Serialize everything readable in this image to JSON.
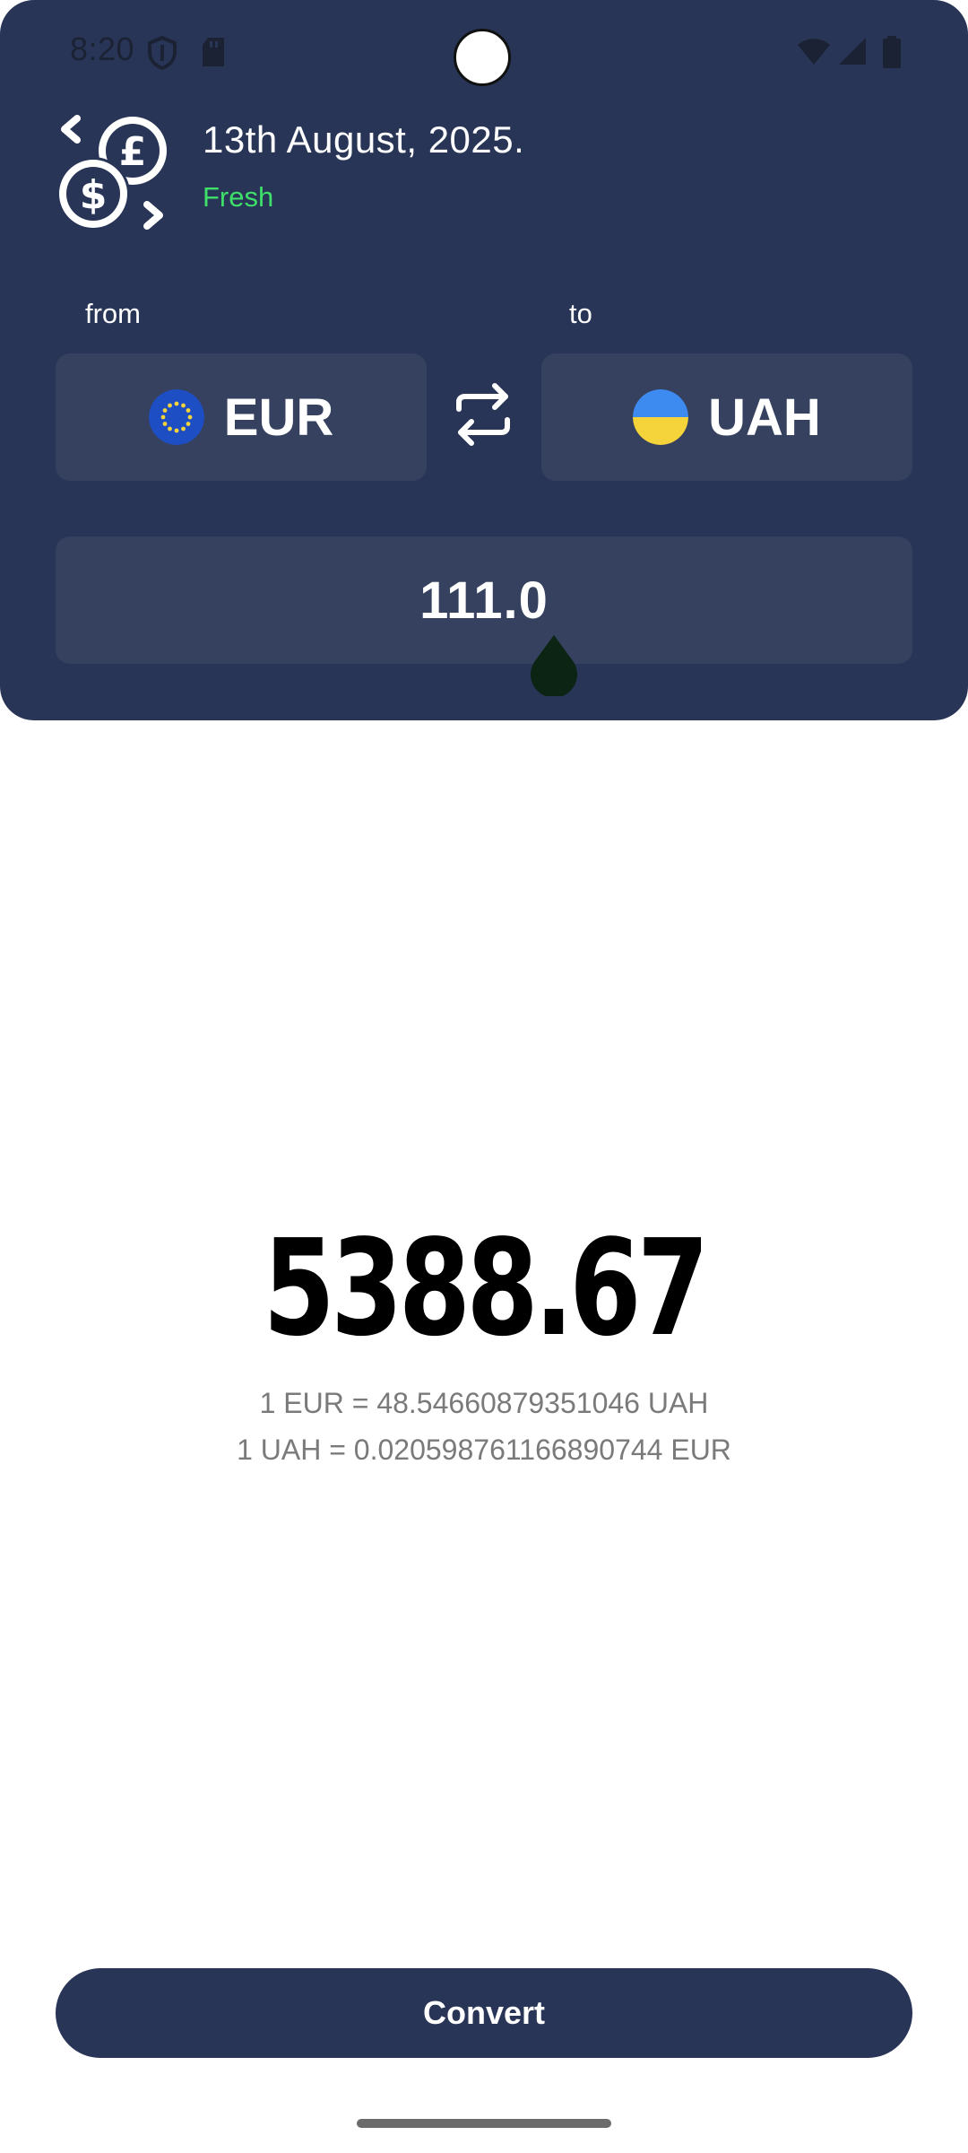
{
  "status_bar": {
    "time": "8:20",
    "icons": [
      "shield-icon",
      "sd-card-icon",
      "wifi-icon",
      "signal-icon",
      "battery-icon"
    ]
  },
  "header": {
    "logo_icon": "currency-exchange-icon",
    "date": "13th August, 2025.",
    "freshness": "Fresh",
    "from_label": "from",
    "to_label": "to",
    "from_currency": "EUR",
    "to_currency": "UAH",
    "from_flag_icon": "eu-flag-icon",
    "to_flag_icon": "ukraine-flag-icon",
    "swap_icon": "swap-arrows-icon",
    "amount": "111.0"
  },
  "result": {
    "value": "5388.67",
    "rate_forward": "1 EUR = 48.54660879351046 UAH",
    "rate_backward": "1 UAH = 0.020598761166890744 EUR"
  },
  "actions": {
    "convert_label": "Convert"
  },
  "colors": {
    "header_bg": "#283556",
    "field_bg": "#35415f",
    "fresh": "#3ee06a",
    "button_bg": "#283556"
  }
}
